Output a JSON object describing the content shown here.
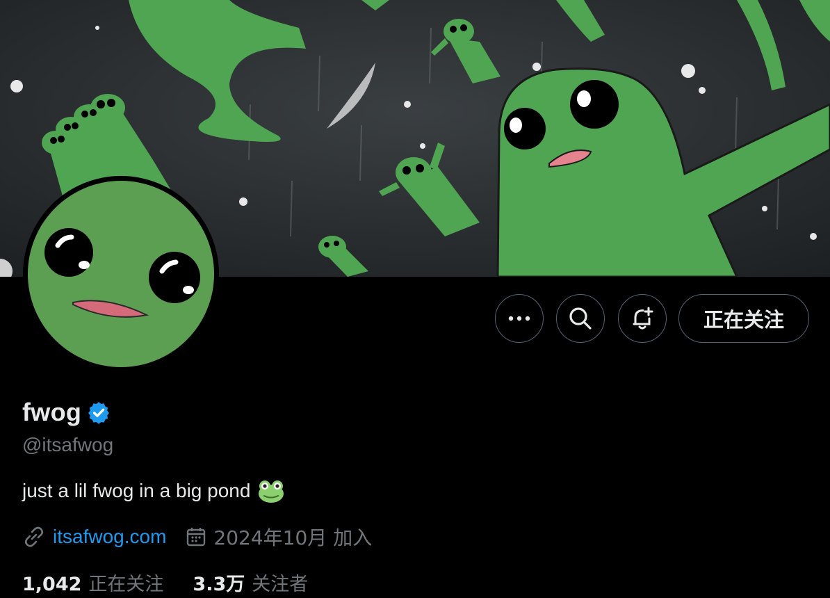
{
  "profile": {
    "display_name": "fwog",
    "handle": "@itsafwog",
    "bio": "just a lil fwog in a big pond",
    "website": "itsafwog.com",
    "joined": "2024年10月 加入",
    "verified": true
  },
  "actions": {
    "more_icon": "more-dots-icon",
    "search_icon": "search-icon",
    "notify_icon": "bell-plus-icon",
    "follow_label": "正在关注"
  },
  "stats": {
    "following_count": "1,042",
    "following_label": "正在关注",
    "followers_count": "3.3万",
    "followers_label": "关注者"
  },
  "colors": {
    "background": "#000000",
    "text": "#e7e9ea",
    "muted": "#71767b",
    "link": "#1d9bf0",
    "verified_badge": "#1d9bf0",
    "frog_green": "#4fa552"
  }
}
